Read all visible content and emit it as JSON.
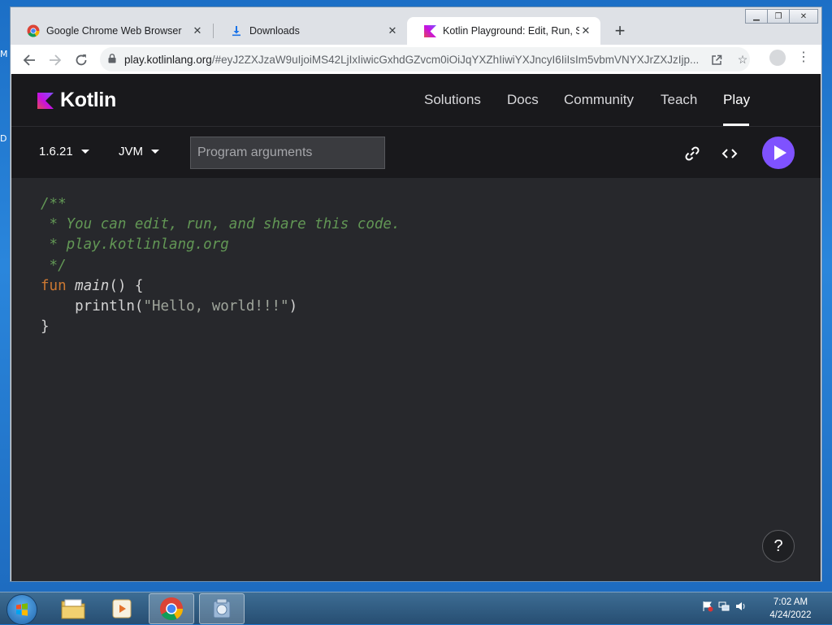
{
  "desktop": {
    "edge_labels": [
      "M",
      "D"
    ]
  },
  "browser": {
    "tabs": [
      {
        "title": "Google Chrome Web Browser",
        "icon": "chrome-icon"
      },
      {
        "title": "Downloads",
        "icon": "download-icon"
      },
      {
        "title": "Kotlin Playground: Edit, Run, Share",
        "icon": "kotlin-icon",
        "active": true
      }
    ],
    "new_tab": "+",
    "url_host": "play.kotlinlang.org",
    "url_rest": "/#eyJ2ZXJzaW9uIjoiMS42LjIxIiwicGxhdGZvcm0iOiJqYXZhIiwiYXJncyI6IiIsIm5vbmVNYXJrZXJzIjp..."
  },
  "site": {
    "logo_text": "Kotlin",
    "nav": [
      "Solutions",
      "Docs",
      "Community",
      "Teach",
      "Play"
    ],
    "active_nav": "Play",
    "accent": "#7f52ff"
  },
  "controls": {
    "version": "1.6.21",
    "platform": "JVM",
    "args_placeholder": "Program arguments"
  },
  "code": {
    "lines": [
      "/**",
      " * You can edit, run, and share this code.",
      " * play.kotlinlang.org",
      " */",
      "fun main() {",
      "    println(\"Hello, world!!!\")",
      "}"
    ]
  },
  "help": "?",
  "taskbar": {
    "time": "7:02 AM",
    "date": "4/24/2022"
  }
}
